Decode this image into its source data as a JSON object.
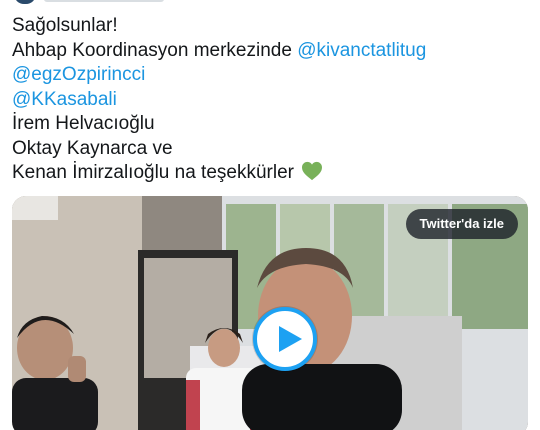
{
  "tweet": {
    "lines": {
      "l1": "Sağolsunlar!",
      "l2_text": "Ahbap Koordinasyon merkezinde ",
      "l2_mention": "@kivanctatlitug",
      "l3_mention": "@egzOzpirincci",
      "l4_mention": "@KKasabali",
      "l5": "İrem Helvacıoğlu",
      "l6": "Oktay Kaynarca ve",
      "l7": "Kenan İmirzalıoğlu na teşekkürler"
    },
    "emoji": "green-heart-icon"
  },
  "video": {
    "watch_label": "Twitter'da izle",
    "play_icon": "play-icon"
  },
  "colors": {
    "text": "#14171a",
    "mention": "#1b95e0",
    "accent": "#1da1f2",
    "heart": "#78b159"
  }
}
